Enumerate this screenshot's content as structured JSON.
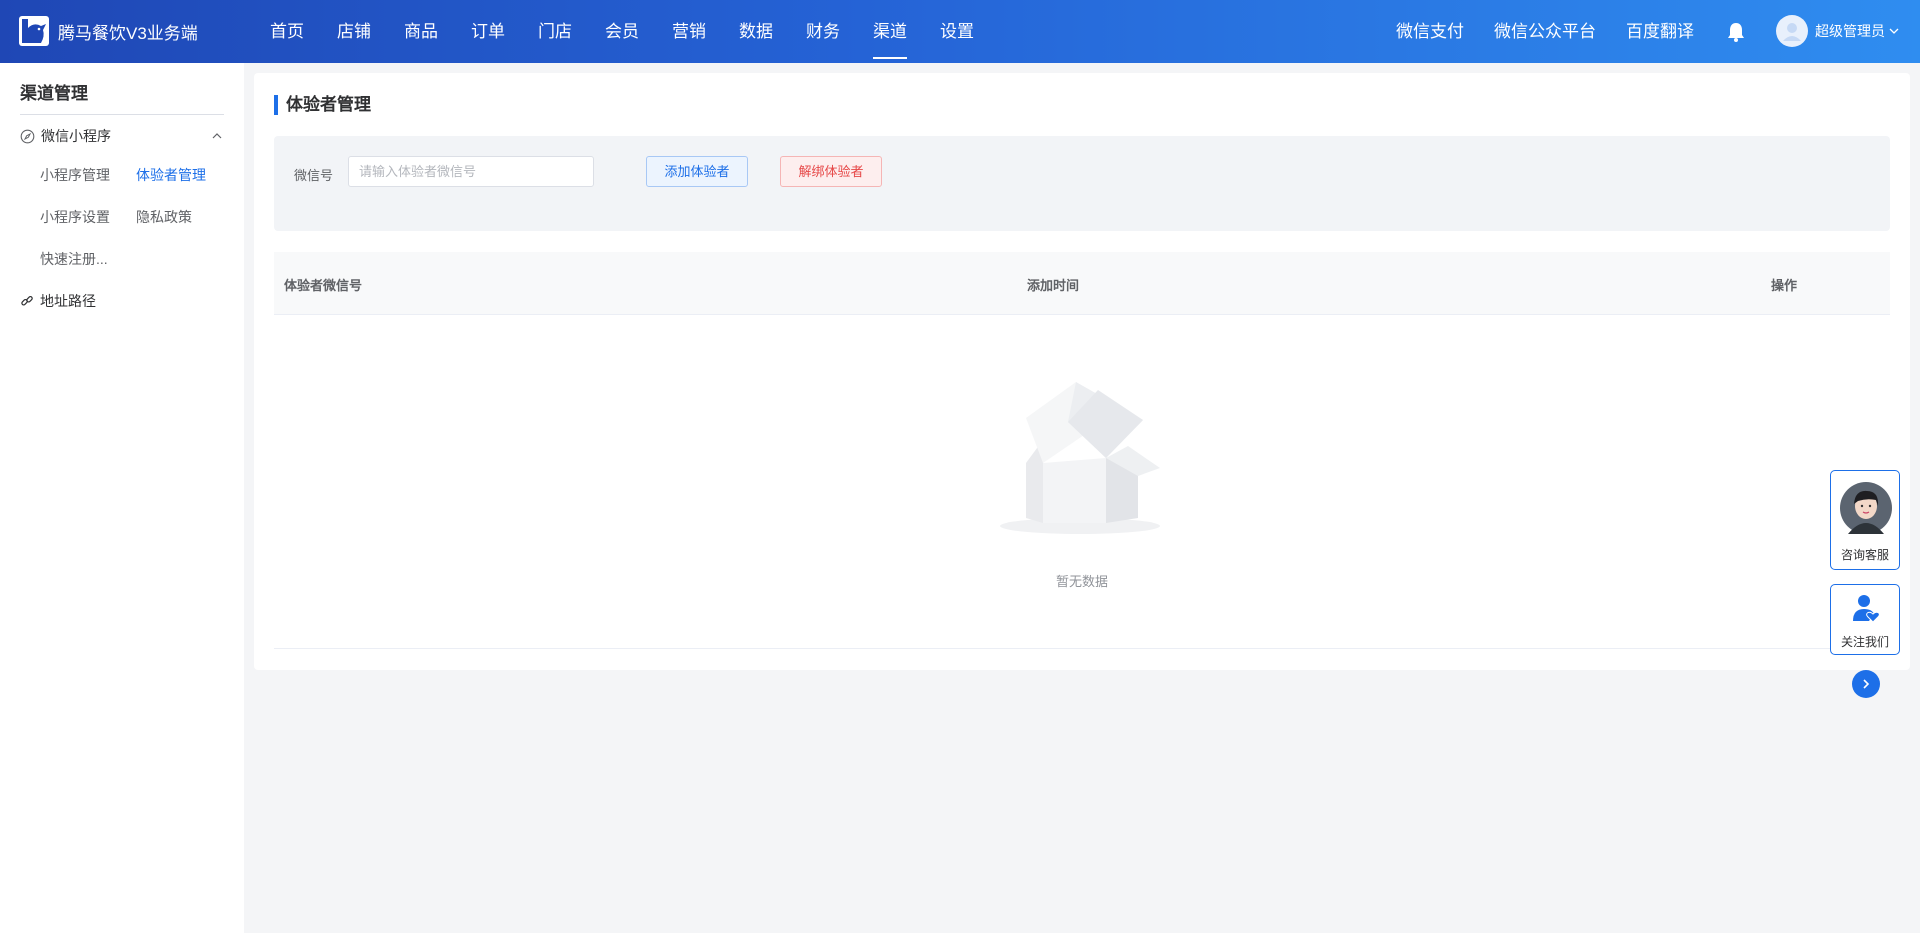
{
  "app": {
    "name": "腾马餐饮V3业务端"
  },
  "nav": {
    "items": [
      "首页",
      "店铺",
      "商品",
      "订单",
      "门店",
      "会员",
      "营销",
      "数据",
      "财务",
      "渠道",
      "设置"
    ],
    "active": "渠道"
  },
  "header_links": [
    "微信支付",
    "微信公众平台",
    "百度翻译"
  ],
  "user": {
    "name": "超级管理员"
  },
  "sidebar": {
    "title": "渠道管理",
    "group": "微信小程序",
    "items": [
      "小程序管理",
      "体验者管理",
      "小程序设置",
      "隐私政策",
      "快速注册..."
    ],
    "active": "体验者管理",
    "address": "地址路径"
  },
  "page": {
    "title": "体验者管理"
  },
  "filter": {
    "label": "微信号",
    "placeholder": "请输入体验者微信号",
    "add_button": "添加体验者",
    "unbind_button": "解绑体验者"
  },
  "table": {
    "columns": [
      "体验者微信号",
      "添加时间",
      "操作"
    ],
    "empty_text": "暂无数据"
  },
  "float": {
    "consult": "咨询客服",
    "follow": "关注我们"
  },
  "colors": {
    "accent": "#1d6fe8",
    "danger": "#e64848",
    "header_start": "#1f47b5",
    "header_end": "#2f8df0"
  }
}
